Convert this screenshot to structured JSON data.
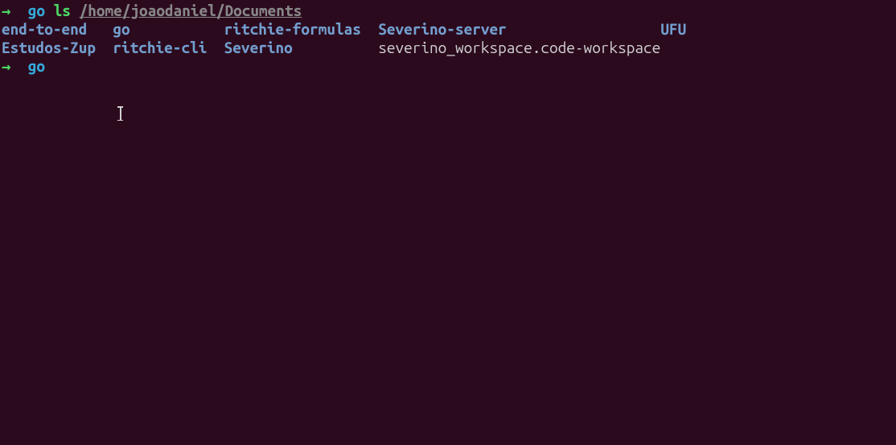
{
  "prompt1": {
    "arrow": "→",
    "dir": "go",
    "cmd": "ls",
    "path": "/home/joaodaniel/Documents"
  },
  "ls": {
    "row1": {
      "c1": "end-to-end",
      "c2": "go",
      "c3": "ritchie-formulas",
      "c4": "Severino-server",
      "c5": "UFU"
    },
    "row2": {
      "c1": "Estudos-Zup",
      "c2": "ritchie-cli",
      "c3": "Severino",
      "c4": "severino_workspace.code-workspace"
    }
  },
  "prompt2": {
    "arrow": "→",
    "dir": "go"
  }
}
